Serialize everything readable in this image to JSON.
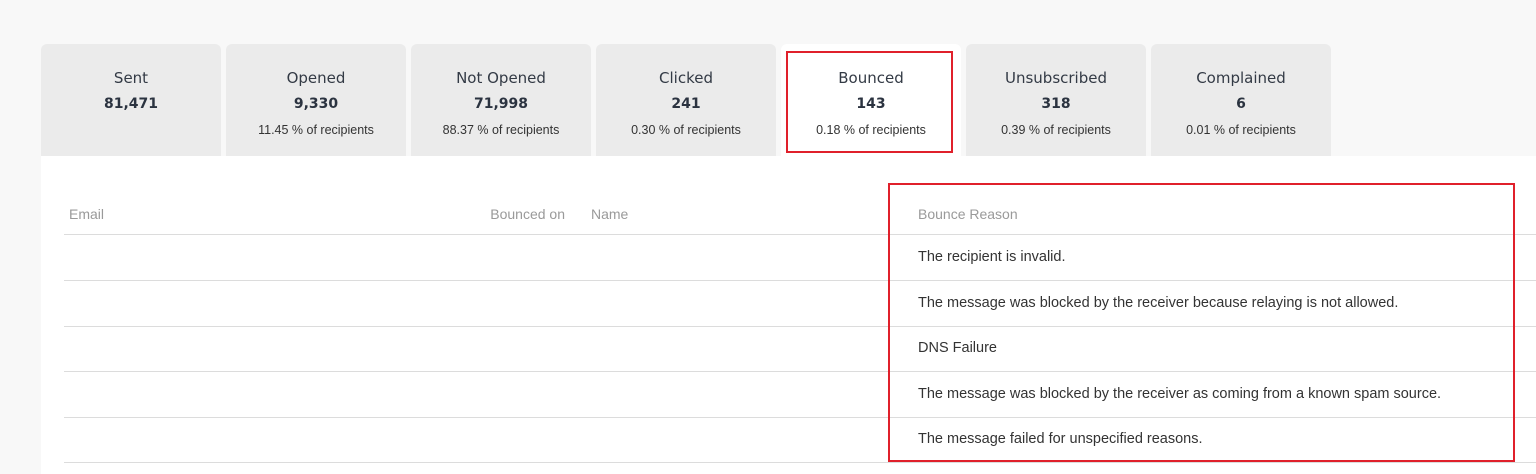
{
  "stats_tabs": [
    {
      "label": "Sent",
      "value": "81,471",
      "percent": ""
    },
    {
      "label": "Opened",
      "value": "9,330",
      "percent": "11.45 % of recipients"
    },
    {
      "label": "Not Opened",
      "value": "71,998",
      "percent": "88.37 % of recipients"
    },
    {
      "label": "Clicked",
      "value": "241",
      "percent": "0.30 % of recipients"
    },
    {
      "label": "Bounced",
      "value": "143",
      "percent": "0.18 % of recipients"
    },
    {
      "label": "Unsubscribed",
      "value": "318",
      "percent": "0.39 % of recipients"
    },
    {
      "label": "Complained",
      "value": "6",
      "percent": "0.01 % of recipients"
    }
  ],
  "active_tab": "Bounced",
  "highlight_color": "#e0202b",
  "table": {
    "headers": {
      "email": "Email",
      "bounced_on": "Bounced on",
      "name": "Name",
      "bounce_reason": "Bounce Reason"
    },
    "rows": [
      {
        "email": "",
        "bounced_on": "",
        "name": "",
        "bounce_reason": "The recipient is invalid."
      },
      {
        "email": "",
        "bounced_on": "",
        "name": "",
        "bounce_reason": "The message was blocked by the receiver because relaying is not allowed."
      },
      {
        "email": "",
        "bounced_on": "",
        "name": "",
        "bounce_reason": "DNS Failure"
      },
      {
        "email": "",
        "bounced_on": "",
        "name": "",
        "bounce_reason": "The message was blocked by the receiver as coming from a known spam source."
      },
      {
        "email": "",
        "bounced_on": "",
        "name": "",
        "bounce_reason": "The message failed for unspecified reasons."
      }
    ]
  }
}
